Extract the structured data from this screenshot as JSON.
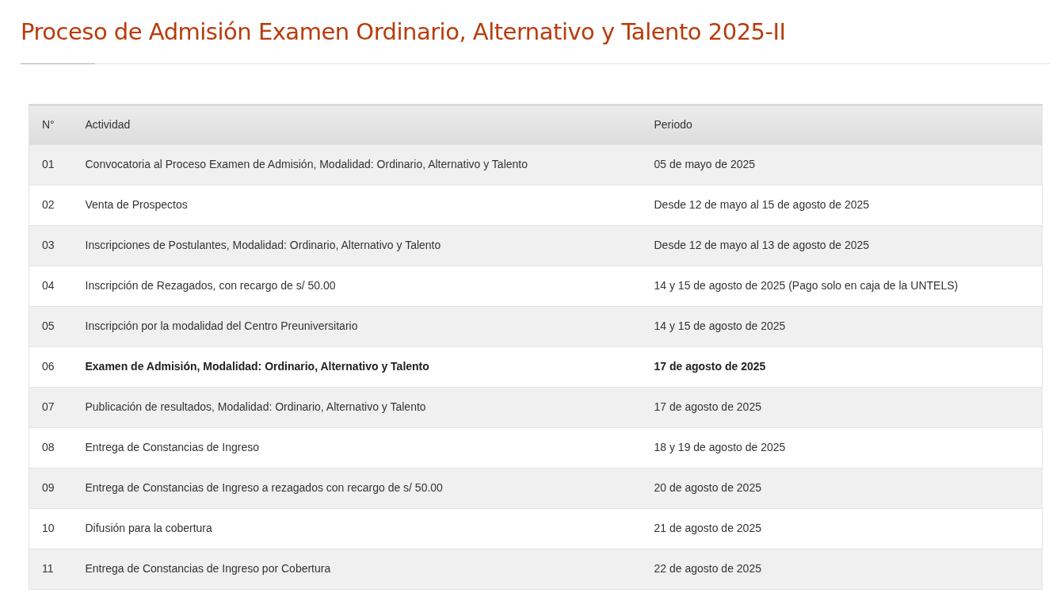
{
  "page_title": "Proceso de Admisión Examen Ordinario, Alternativo y Talento 2025-II",
  "table": {
    "columns": [
      "N°",
      "Actividad",
      "Periodo"
    ],
    "rows": [
      {
        "number": "01",
        "activity": "Convocatoria al Proceso Examen de Admisión, Modalidad: Ordinario, Alternativo y Talento",
        "period": "05 de mayo de 2025",
        "emphasized": false
      },
      {
        "number": "02",
        "activity": "Venta de Prospectos",
        "period": "Desde 12 de mayo al 15 de agosto de 2025",
        "emphasized": false
      },
      {
        "number": "03",
        "activity": "Inscripciones de Postulantes, Modalidad: Ordinario, Alternativo y Talento",
        "period": "Desde 12 de mayo al 13 de agosto de 2025",
        "emphasized": false
      },
      {
        "number": "04",
        "activity": "Inscripción de Rezagados, con recargo de s/ 50.00",
        "period": "14 y 15 de agosto de 2025 (Pago solo en caja de la UNTELS)",
        "emphasized": false
      },
      {
        "number": "05",
        "activity": "Inscripción por la modalidad del Centro Preuniversitario",
        "period": "14 y 15 de agosto de 2025",
        "emphasized": false
      },
      {
        "number": "06",
        "activity": "Examen de Admisión, Modalidad: Ordinario, Alternativo y Talento",
        "period": "17 de agosto de 2025",
        "emphasized": true
      },
      {
        "number": "07",
        "activity": "Publicación de resultados, Modalidad: Ordinario, Alternativo y Talento",
        "period": "17 de agosto de 2025",
        "emphasized": false
      },
      {
        "number": "08",
        "activity": "Entrega de Constancias de Ingreso",
        "period": "18 y 19 de agosto de 2025",
        "emphasized": false
      },
      {
        "number": "09",
        "activity": "Entrega de Constancias de Ingreso a rezagados con recargo de s/ 50.00",
        "period": "20 de agosto de 2025",
        "emphasized": false
      },
      {
        "number": "10",
        "activity": "Difusión para la cobertura",
        "period": "21 de agosto de 2025",
        "emphasized": false
      },
      {
        "number": "11",
        "activity": "Entrega de Constancias de Ingreso por Cobertura",
        "period": "22 de agosto de 2025",
        "emphasized": false
      }
    ]
  }
}
